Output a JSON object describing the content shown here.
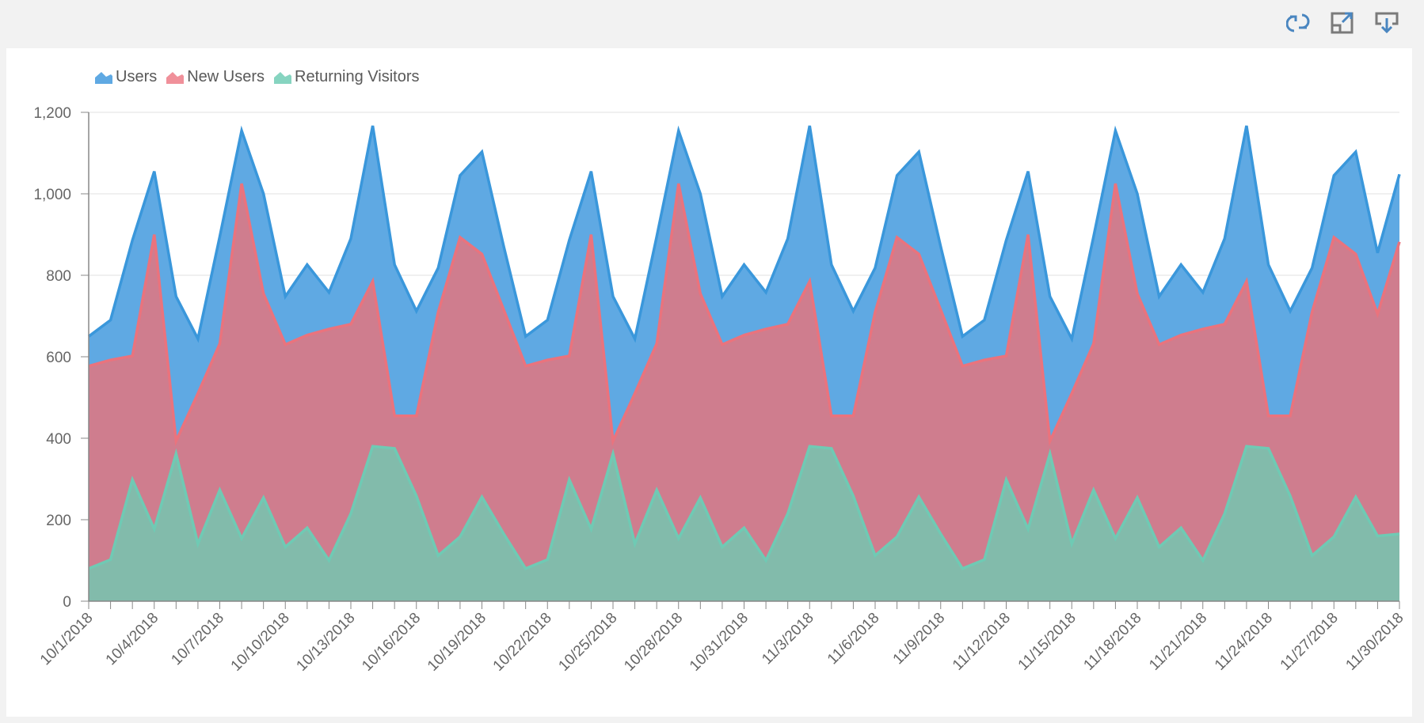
{
  "toolbar": {
    "icons": [
      "refresh-icon",
      "expand-icon",
      "download-icon"
    ]
  },
  "colors": {
    "users_fill": "#5fa9e3",
    "users_line": "#3a97db",
    "new_users_fill": "#cf7d8e",
    "new_users_line": "#ea737d",
    "returning_fill": "#82bbab",
    "returning_line": "#6fcab4",
    "axis": "#888888",
    "grid": "#e1e1e1",
    "text": "#666666"
  },
  "chart_data": {
    "type": "area",
    "title": "",
    "xlabel": "",
    "ylabel": "",
    "ylim": [
      0,
      1200
    ],
    "y_ticks": [
      0,
      200,
      400,
      600,
      800,
      1000,
      1200
    ],
    "y_tick_labels": [
      "0",
      "200",
      "400",
      "600",
      "800",
      "1,000",
      "1,200"
    ],
    "grid": "horizontal",
    "legend_position": "top-left",
    "x_tick_label_every": 3,
    "categories": [
      "10/1/2018",
      "10/2/2018",
      "10/3/2018",
      "10/4/2018",
      "10/5/2018",
      "10/6/2018",
      "10/7/2018",
      "10/8/2018",
      "10/9/2018",
      "10/10/2018",
      "10/11/2018",
      "10/12/2018",
      "10/13/2018",
      "10/14/2018",
      "10/15/2018",
      "10/16/2018",
      "10/17/2018",
      "10/18/2018",
      "10/19/2018",
      "10/20/2018",
      "10/21/2018",
      "10/22/2018",
      "10/23/2018",
      "10/24/2018",
      "10/25/2018",
      "10/26/2018",
      "10/27/2018",
      "10/28/2018",
      "10/29/2018",
      "10/30/2018",
      "10/31/2018",
      "11/1/2018",
      "11/2/2018",
      "11/3/2018",
      "11/4/2018",
      "11/5/2018",
      "11/6/2018",
      "11/7/2018",
      "11/8/2018",
      "11/9/2018",
      "11/10/2018",
      "11/11/2018",
      "11/12/2018",
      "11/13/2018",
      "11/14/2018",
      "11/15/2018",
      "11/16/2018",
      "11/17/2018",
      "11/18/2018",
      "11/19/2018",
      "11/20/2018",
      "11/21/2018",
      "11/22/2018",
      "11/23/2018",
      "11/24/2018",
      "11/25/2018",
      "11/26/2018",
      "11/27/2018",
      "11/28/2018",
      "11/29/2018",
      "11/30/2018"
    ],
    "series": [
      {
        "name": "Users",
        "values": [
          650,
          690,
          886,
          1055,
          748,
          644,
          895,
          1155,
          1000,
          748,
          826,
          758,
          890,
          1167,
          826,
          712,
          818,
          1045,
          1103,
          870,
          650,
          690,
          886,
          1055,
          748,
          644,
          895,
          1155,
          1000,
          748,
          826,
          758,
          890,
          1167,
          826,
          712,
          818,
          1045,
          1103,
          870,
          650,
          690,
          886,
          1055,
          748,
          644,
          895,
          1155,
          1000,
          748,
          826,
          758,
          890,
          1167,
          826,
          712,
          818,
          1045,
          1103,
          855,
          1048
        ]
      },
      {
        "name": "New Users",
        "values": [
          577,
          592,
          602,
          900,
          393,
          510,
          632,
          1025,
          755,
          630,
          653,
          668,
          680,
          785,
          455,
          455,
          710,
          893,
          852,
          715,
          577,
          592,
          602,
          900,
          393,
          510,
          632,
          1025,
          755,
          630,
          653,
          668,
          680,
          785,
          455,
          455,
          710,
          893,
          852,
          715,
          577,
          592,
          602,
          900,
          393,
          510,
          632,
          1025,
          755,
          630,
          653,
          668,
          680,
          785,
          455,
          455,
          710,
          893,
          852,
          705,
          882
        ]
      },
      {
        "name": "Returning Visitors",
        "values": [
          80,
          102,
          298,
          177,
          362,
          141,
          273,
          154,
          254,
          133,
          180,
          100,
          215,
          380,
          375,
          258,
          112,
          158,
          256,
          165,
          80,
          102,
          298,
          177,
          362,
          141,
          273,
          154,
          254,
          133,
          180,
          100,
          215,
          380,
          375,
          258,
          112,
          158,
          256,
          165,
          80,
          102,
          298,
          177,
          362,
          141,
          273,
          154,
          254,
          133,
          180,
          100,
          215,
          380,
          375,
          258,
          112,
          158,
          256,
          160,
          165
        ]
      }
    ]
  }
}
